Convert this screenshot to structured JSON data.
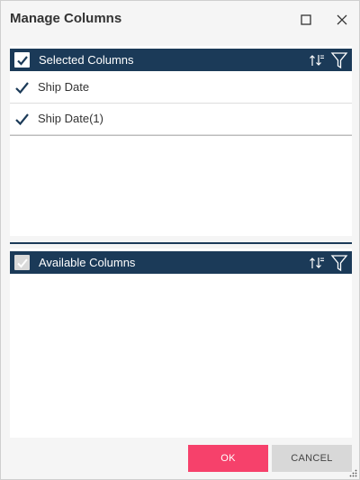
{
  "dialog": {
    "title": "Manage Columns",
    "maximize_icon": "maximize-icon",
    "close_icon": "close-icon"
  },
  "selected_panel": {
    "header_label": "Selected Columns",
    "header_checked": true,
    "sort_icon": "sort-icon",
    "filter_icon": "filter-icon",
    "items": [
      {
        "label": "Ship Date",
        "checked": true
      },
      {
        "label": "Ship Date(1)",
        "checked": true
      }
    ]
  },
  "available_panel": {
    "header_label": "Available Columns",
    "header_checked": true,
    "header_enabled": false,
    "sort_icon": "sort-icon",
    "filter_icon": "filter-icon",
    "items": []
  },
  "footer": {
    "ok_label": "OK",
    "cancel_label": "CANCEL"
  },
  "colors": {
    "header_bg": "#1b3a58",
    "ok_bg": "#f6416b",
    "cancel_bg": "#d8d8d8",
    "check": "#1b3a58"
  }
}
